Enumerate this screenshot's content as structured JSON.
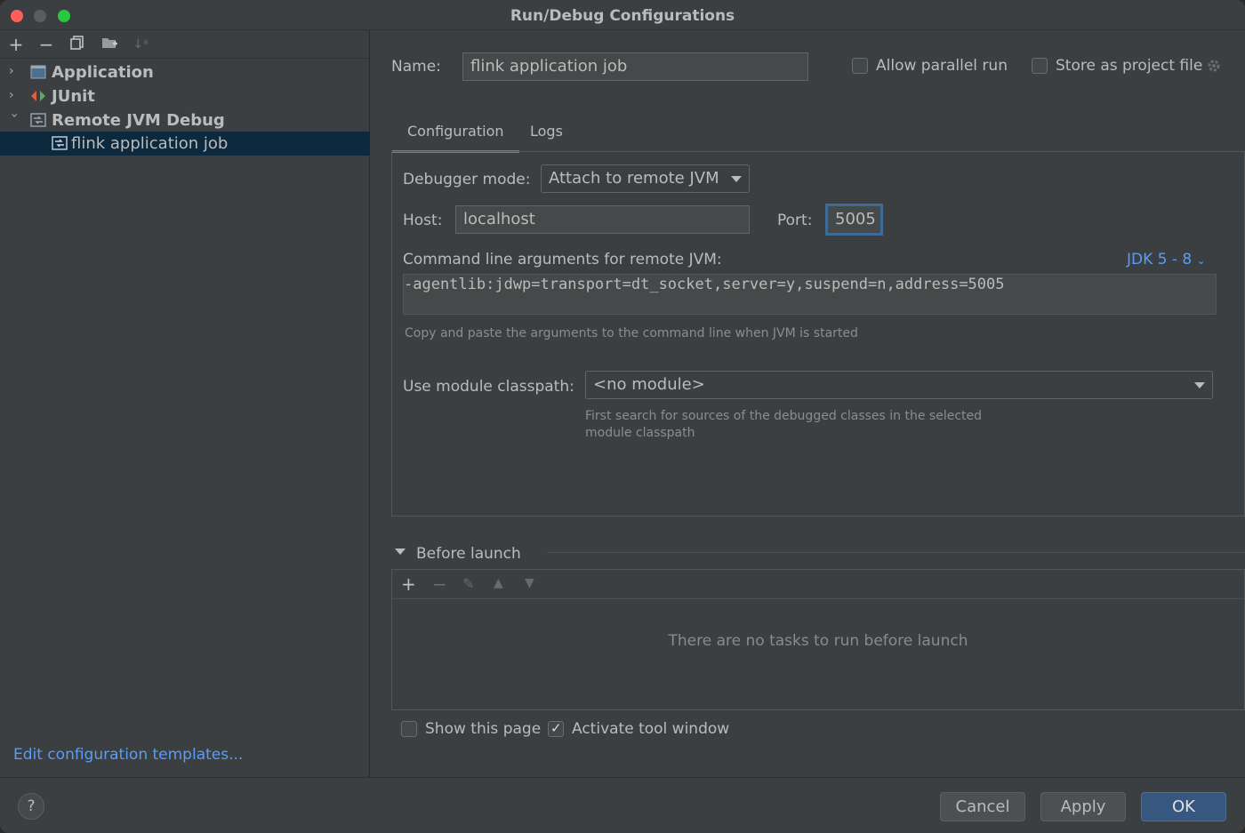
{
  "window": {
    "title": "Run/Debug Configurations"
  },
  "left": {
    "toolbar": [
      "add-icon",
      "remove-icon",
      "copy-icon",
      "new-folder-icon",
      "sort-icon"
    ],
    "tree": [
      {
        "label": "Application",
        "expanded": false,
        "bold": true,
        "icon": "application-icon"
      },
      {
        "label": "JUnit",
        "expanded": false,
        "bold": true,
        "icon": "junit-icon"
      },
      {
        "label": "Remote JVM Debug",
        "expanded": true,
        "bold": true,
        "icon": "remote-debug-icon"
      },
      {
        "label": "flink application job",
        "selected": true,
        "icon": "remote-debug-icon"
      }
    ],
    "edit_templates_link": "Edit configuration templates..."
  },
  "right": {
    "name_label": "Name:",
    "name_value": "flink application job",
    "allow_parallel_label": "Allow parallel run",
    "store_project_label": "Store as project file",
    "tabs": [
      "Configuration",
      "Logs"
    ],
    "debugger_mode_label": "Debugger mode:",
    "debugger_mode_value": "Attach to remote JVM",
    "host_label": "Host:",
    "host_value": "localhost",
    "port_label": "Port:",
    "port_value": "5005",
    "cmd_label": "Command line arguments for remote JVM:",
    "jdk_link": "JDK 5 - 8",
    "cmd_value": "-agentlib:jdwp=transport=dt_socket,server=y,suspend=n,address=5005",
    "cmd_hint": "Copy and paste the arguments to the command line when JVM is started",
    "module_label": "Use module classpath:",
    "module_value": "<no module>",
    "module_hint_1": "First search for sources of the debugged classes in the selected",
    "module_hint_2": "module classpath",
    "before_launch_title": "Before launch",
    "before_launch_empty": "There are no tasks to run before launch",
    "show_page_label": "Show this page",
    "activate_tool_label": "Activate tool window"
  },
  "footer": {
    "help": "?",
    "cancel": "Cancel",
    "apply": "Apply",
    "ok": "OK"
  },
  "colors": {
    "accent": "#4a88c7",
    "link": "#589df6",
    "primary_button": "#365880",
    "selection": "#0d293e"
  }
}
